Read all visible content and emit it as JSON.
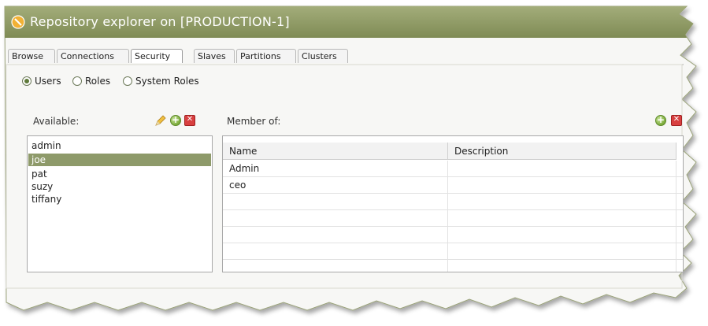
{
  "window": {
    "title": "Repository explorer on [PRODUCTION-1]",
    "title_bar_color": "#8a9661"
  },
  "tabs": [
    {
      "label": "Browse",
      "active": false
    },
    {
      "label": "Connections",
      "active": false
    },
    {
      "label": "Security",
      "active": true
    },
    {
      "label": "Slaves",
      "active": false
    },
    {
      "label": "Partitions",
      "active": false
    },
    {
      "label": "Clusters",
      "active": false
    }
  ],
  "radios": [
    {
      "label": "Users",
      "selected": true
    },
    {
      "label": "Roles",
      "selected": false
    },
    {
      "label": "System Roles",
      "selected": false
    }
  ],
  "available": {
    "label": "Available:",
    "icons": [
      "pencil-icon",
      "add-icon",
      "delete-icon"
    ],
    "users": [
      "admin",
      "joe",
      "pat",
      "suzy",
      "tiffany"
    ],
    "selected_user": "joe"
  },
  "member_of": {
    "label": "Member of:",
    "icons": [
      "add-icon",
      "delete-icon"
    ],
    "columns": [
      "Name",
      "Description"
    ],
    "rows": [
      {
        "name": "Admin",
        "description": ""
      },
      {
        "name": "ceo",
        "description": ""
      },
      {
        "name": "",
        "description": ""
      },
      {
        "name": "",
        "description": ""
      },
      {
        "name": "",
        "description": ""
      },
      {
        "name": "",
        "description": ""
      },
      {
        "name": "",
        "description": ""
      }
    ]
  },
  "colors": {
    "accent": "#8a9661",
    "selection": "#8e9a6a",
    "add_green": "#7aaa3a",
    "delete_red": "#d84040"
  }
}
